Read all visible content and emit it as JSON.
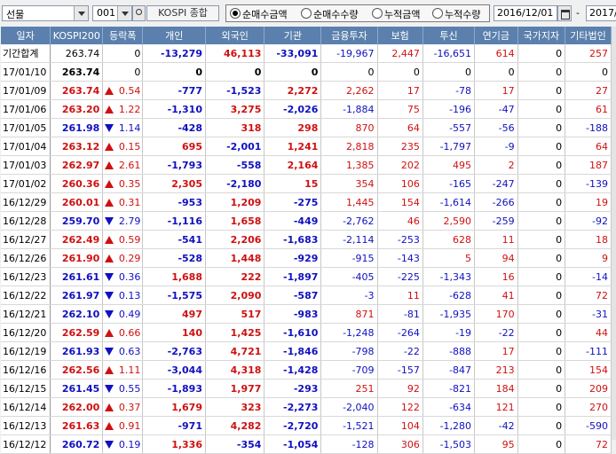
{
  "toolbar": {
    "market_select": "선물",
    "code_select": "001",
    "index_label": "KOSPI 종합",
    "radios": [
      {
        "label": "순매수금액",
        "checked": true
      },
      {
        "label": "순매수수량",
        "checked": false
      },
      {
        "label": "누적금액",
        "checked": false
      },
      {
        "label": "누적수량",
        "checked": false
      }
    ],
    "date_from": "2016/12/01",
    "date_sep": "-",
    "date_to": "2017/"
  },
  "columns": [
    "일자",
    "KOSPI200",
    "등락폭",
    "개인",
    "외국인",
    "기관",
    "금융투자",
    "보험",
    "투신",
    "연기금",
    "국가지자",
    "기타법인"
  ],
  "rows": [
    {
      "date": "기간합계",
      "kospi": "263.74",
      "dir": "",
      "chg": "0",
      "v": [
        "-13,279",
        "46,113",
        "-33,091",
        "-19,967",
        "2,447",
        "-16,651",
        "614",
        "0",
        "257"
      ],
      "total": true
    },
    {
      "date": "17/01/10",
      "kospi": "263.74",
      "dir": "",
      "chg": "0",
      "v": [
        "0",
        "0",
        "0",
        "0",
        "0",
        "0",
        "0",
        "0",
        "0"
      ],
      "zero": true
    },
    {
      "date": "17/01/09",
      "kospi": "263.74",
      "dir": "up",
      "chg": "0.54",
      "v": [
        "-777",
        "-1,523",
        "2,272",
        "2,262",
        "17",
        "-78",
        "17",
        "0",
        "27"
      ]
    },
    {
      "date": "17/01/06",
      "kospi": "263.20",
      "dir": "up",
      "chg": "1.22",
      "v": [
        "-1,310",
        "3,275",
        "-2,026",
        "-1,884",
        "75",
        "-196",
        "-47",
        "0",
        "61"
      ]
    },
    {
      "date": "17/01/05",
      "kospi": "261.98",
      "dir": "dn",
      "chg": "1.14",
      "v": [
        "-428",
        "318",
        "298",
        "870",
        "64",
        "-557",
        "-56",
        "0",
        "-188"
      ]
    },
    {
      "date": "17/01/04",
      "kospi": "263.12",
      "dir": "up",
      "chg": "0.15",
      "v": [
        "695",
        "-2,001",
        "1,241",
        "2,818",
        "235",
        "-1,797",
        "-9",
        "0",
        "64"
      ]
    },
    {
      "date": "17/01/03",
      "kospi": "262.97",
      "dir": "up",
      "chg": "2.61",
      "v": [
        "-1,793",
        "-558",
        "2,164",
        "1,385",
        "202",
        "495",
        "2",
        "0",
        "187"
      ]
    },
    {
      "date": "17/01/02",
      "kospi": "260.36",
      "dir": "up",
      "chg": "0.35",
      "v": [
        "2,305",
        "-2,180",
        "15",
        "354",
        "106",
        "-165",
        "-247",
        "0",
        "-139"
      ]
    },
    {
      "date": "16/12/29",
      "kospi": "260.01",
      "dir": "up",
      "chg": "0.31",
      "v": [
        "-953",
        "1,209",
        "-275",
        "1,445",
        "154",
        "-1,614",
        "-266",
        "0",
        "19"
      ]
    },
    {
      "date": "16/12/28",
      "kospi": "259.70",
      "dir": "dn",
      "chg": "2.79",
      "v": [
        "-1,116",
        "1,658",
        "-449",
        "-2,762",
        "46",
        "2,590",
        "-259",
        "0",
        "-92"
      ]
    },
    {
      "date": "16/12/27",
      "kospi": "262.49",
      "dir": "up",
      "chg": "0.59",
      "v": [
        "-541",
        "2,206",
        "-1,683",
        "-2,114",
        "-253",
        "628",
        "11",
        "0",
        "18"
      ]
    },
    {
      "date": "16/12/26",
      "kospi": "261.90",
      "dir": "up",
      "chg": "0.29",
      "v": [
        "-528",
        "1,448",
        "-929",
        "-915",
        "-143",
        "5",
        "94",
        "0",
        "9"
      ]
    },
    {
      "date": "16/12/23",
      "kospi": "261.61",
      "dir": "dn",
      "chg": "0.36",
      "v": [
        "1,688",
        "222",
        "-1,897",
        "-405",
        "-225",
        "-1,343",
        "16",
        "0",
        "-14"
      ]
    },
    {
      "date": "16/12/22",
      "kospi": "261.97",
      "dir": "dn",
      "chg": "0.13",
      "v": [
        "-1,575",
        "2,090",
        "-587",
        "-3",
        "11",
        "-628",
        "41",
        "0",
        "72"
      ]
    },
    {
      "date": "16/12/21",
      "kospi": "262.10",
      "dir": "dn",
      "chg": "0.49",
      "v": [
        "497",
        "517",
        "-983",
        "871",
        "-81",
        "-1,935",
        "170",
        "0",
        "-31"
      ]
    },
    {
      "date": "16/12/20",
      "kospi": "262.59",
      "dir": "up",
      "chg": "0.66",
      "v": [
        "140",
        "1,425",
        "-1,610",
        "-1,248",
        "-264",
        "-19",
        "-22",
        "0",
        "44"
      ]
    },
    {
      "date": "16/12/19",
      "kospi": "261.93",
      "dir": "dn",
      "chg": "0.63",
      "v": [
        "-2,763",
        "4,721",
        "-1,846",
        "-798",
        "-22",
        "-888",
        "17",
        "0",
        "-111"
      ]
    },
    {
      "date": "16/12/16",
      "kospi": "262.56",
      "dir": "up",
      "chg": "1.11",
      "v": [
        "-3,044",
        "4,318",
        "-1,428",
        "-709",
        "-157",
        "-847",
        "213",
        "0",
        "154"
      ]
    },
    {
      "date": "16/12/15",
      "kospi": "261.45",
      "dir": "dn",
      "chg": "0.55",
      "v": [
        "-1,893",
        "1,977",
        "-293",
        "251",
        "92",
        "-821",
        "184",
        "0",
        "209"
      ]
    },
    {
      "date": "16/12/14",
      "kospi": "262.00",
      "dir": "up",
      "chg": "0.37",
      "v": [
        "1,679",
        "323",
        "-2,273",
        "-2,040",
        "122",
        "-634",
        "121",
        "0",
        "270"
      ]
    },
    {
      "date": "16/12/13",
      "kospi": "261.63",
      "dir": "up",
      "chg": "0.91",
      "v": [
        "-971",
        "4,282",
        "-2,720",
        "-1,521",
        "104",
        "-1,280",
        "-42",
        "0",
        "-590"
      ]
    },
    {
      "date": "16/12/12",
      "kospi": "260.72",
      "dir": "dn",
      "chg": "0.19",
      "v": [
        "1,336",
        "-354",
        "-1,054",
        "-128",
        "306",
        "-1,503",
        "95",
        "0",
        "72"
      ]
    }
  ],
  "colors": {
    "header_bg": "#5b80ad",
    "positive": "#d01010",
    "negative": "#1010c0"
  }
}
